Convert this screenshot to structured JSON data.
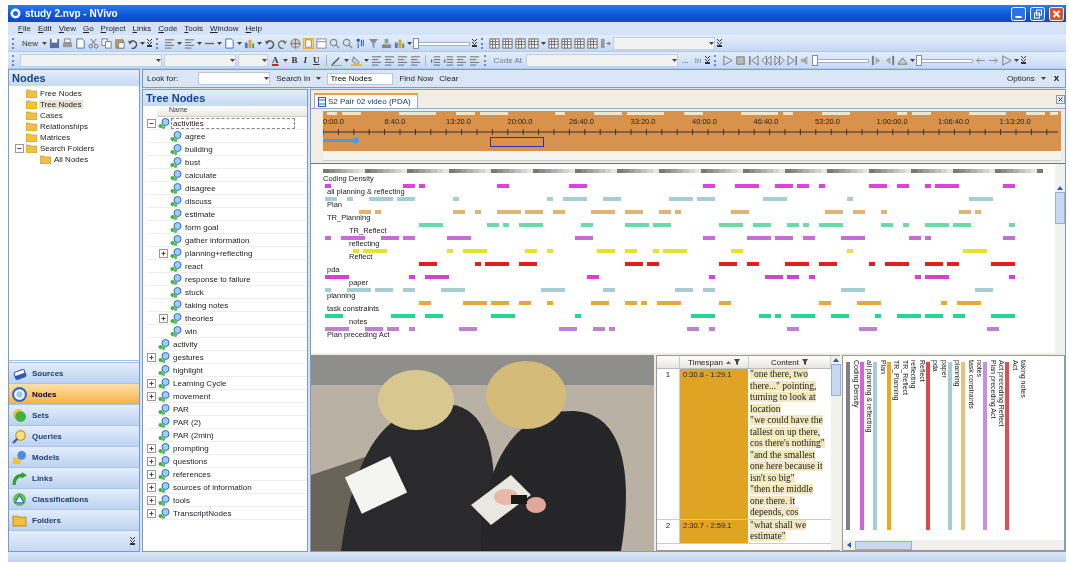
{
  "window": {
    "title": "study 2.nvp - NVivo"
  },
  "menu": [
    "File",
    "Edit",
    "View",
    "Go",
    "Project",
    "Links",
    "Code",
    "Tools",
    "Window",
    "Help"
  ],
  "toolbar": {
    "new_button": "New",
    "format_buttons": [
      "A",
      "B",
      "I",
      "U"
    ],
    "code_at": {
      "label": "Code At",
      "disabled": true
    },
    "ellipsis": "...",
    "in_button": {
      "label": "In",
      "disabled": true
    },
    "sliders": [
      {
        "level": 0
      },
      {
        "level": 0
      },
      {
        "level": 0
      }
    ]
  },
  "find_bar": {
    "look_for_label": "Look for:",
    "search_in": "Search In",
    "search_in_value": "Tree Nodes",
    "find_now": "Find Now",
    "clear": "Clear",
    "options": "Options",
    "close": "X"
  },
  "navigation": {
    "title": "Nodes",
    "folders": [
      {
        "label": "Free Nodes",
        "selected": false
      },
      {
        "label": "Tree Nodes",
        "selected": true
      },
      {
        "label": "Cases",
        "selected": false
      },
      {
        "label": "Relationships",
        "selected": false
      },
      {
        "label": "Matrices",
        "selected": false
      },
      {
        "label": "Search Folders",
        "selected": false,
        "expanded": true,
        "children": [
          {
            "label": "All Nodes",
            "selected": false
          }
        ]
      }
    ],
    "buttons": [
      {
        "label": "Sources",
        "selected": false
      },
      {
        "label": "Nodes",
        "selected": true
      },
      {
        "label": "Sets",
        "selected": false
      },
      {
        "label": "Queries",
        "selected": false
      },
      {
        "label": "Models",
        "selected": false
      },
      {
        "label": "Links",
        "selected": false
      },
      {
        "label": "Classifications",
        "selected": false
      },
      {
        "label": "Folders",
        "selected": false
      }
    ]
  },
  "node_list": {
    "title": "Tree Nodes",
    "column": "Name",
    "nodes": [
      {
        "label": "activities",
        "selected": true,
        "expanded": true,
        "children": [
          {
            "label": "agree",
            "selected": false
          },
          {
            "label": "building",
            "selected": false
          },
          {
            "label": "bust",
            "selected": false
          },
          {
            "label": "calculate",
            "selected": false
          },
          {
            "label": "disagree",
            "selected": false
          },
          {
            "label": "discuss",
            "selected": false
          },
          {
            "label": "estimate",
            "selected": false
          },
          {
            "label": "form goal",
            "selected": false
          },
          {
            "label": "gather information",
            "selected": false
          },
          {
            "label": "planning+reflecting",
            "selected": false,
            "expanded": false
          },
          {
            "label": "react",
            "selected": false
          },
          {
            "label": "response to failure",
            "selected": false
          },
          {
            "label": "stuck",
            "selected": false
          },
          {
            "label": "taking notes",
            "selected": false
          },
          {
            "label": "theories",
            "selected": false,
            "expanded": false
          },
          {
            "label": "win",
            "selected": false
          }
        ]
      },
      {
        "label": "activity",
        "selected": false
      },
      {
        "label": "gestures",
        "selected": false,
        "expanded": false
      },
      {
        "label": "highlight",
        "selected": false
      },
      {
        "label": "Learning Cycle",
        "selected": false,
        "expanded": false
      },
      {
        "label": "movement",
        "selected": false,
        "expanded": false
      },
      {
        "label": "PAR",
        "selected": false
      },
      {
        "label": "PAR (2)",
        "selected": false
      },
      {
        "label": "PAR (2min)",
        "selected": false
      },
      {
        "label": "prompting",
        "selected": false,
        "expanded": false
      },
      {
        "label": "questions",
        "selected": false,
        "expanded": false
      },
      {
        "label": "references",
        "selected": false,
        "expanded": false
      },
      {
        "label": "sources of information",
        "selected": false,
        "expanded": false
      },
      {
        "label": "tools",
        "selected": false,
        "expanded": false
      },
      {
        "label": "TranscriptNodes",
        "selected": false,
        "expanded": false
      }
    ]
  },
  "document_tab": {
    "label": "S2 Pair 02 video (PDA)",
    "selected": true
  },
  "timeline": {
    "ticks": [
      "0:00.0",
      "6:40.0",
      "13:20.0",
      "20:00.0",
      "26:40.0",
      "33:20.0",
      "40:00.0",
      "46:40.0",
      "53:20.0",
      "1:00:00.0",
      "1:06:40.0",
      "1:13:20.0"
    ]
  },
  "coding_stripes": {
    "density_label": "Coding Density",
    "stripes": [
      {
        "label": "all planning & reflecting",
        "color": "#e040e0"
      },
      {
        "label": "Plan",
        "color": "#a8ccd4"
      },
      {
        "label": "TR_Planning",
        "color": "#e0b474",
        "children": [
          {
            "label": "TR_Reflect",
            "color": "#70d8a8"
          },
          {
            "label": "reflecting",
            "color": "#c070d0"
          },
          {
            "label": "Reflect",
            "color": "#e8e030"
          }
        ]
      },
      {
        "label": "pda",
        "color": "#e02020",
        "children": [
          {
            "label": "paper",
            "color": "#d840d0"
          }
        ]
      },
      {
        "label": "planning",
        "color": "#a8ccd4"
      },
      {
        "label": "task constraints",
        "color": "#e8a838",
        "children": [
          {
            "label": "notes",
            "color": "#20d890"
          }
        ]
      },
      {
        "label": "Plan preceding Act",
        "color": "#c080d0"
      }
    ]
  },
  "transcript": {
    "columns": [
      "Timespan",
      "Content"
    ],
    "rows": [
      {
        "number": "1",
        "timespan": "0:30.8 - 1:29.1",
        "content": [
          "\"one there, two there...\" pointing, turning to look at location",
          "\"we could have the tallest on up there, cos there's nothing\"",
          "\"and the smallest one here because it isn't so big\"",
          "\"then the middle one there.  it depends, cos"
        ]
      },
      {
        "number": "2",
        "timespan": "2:30.7 - 2:59.1",
        "content": [
          "\"what shall we estimate\""
        ]
      }
    ]
  },
  "vertical_stripes": [
    {
      "label": "Coding Density",
      "color": "#808080"
    },
    {
      "label": "all planning & reflecting",
      "color": "#d860d8"
    },
    {
      "label": "Plan",
      "color": "#a8ccd4"
    },
    {
      "label": "TR_Planning",
      "color": "#f0a818"
    },
    {
      "label": "TR_Reflect"
    },
    {
      "label": "reflecting"
    },
    {
      "label": "Reflect"
    },
    {
      "label": "pda",
      "color": "#e04848"
    },
    {
      "label": "paper"
    },
    {
      "label": "planning",
      "color": "#a8ccd4"
    },
    {
      "label": "task constraints",
      "color": "#e8c080"
    },
    {
      "label": "notes"
    },
    {
      "label": "Plan preceding Act",
      "color": "#c890d8"
    },
    {
      "label": "Act preceding Reflect"
    },
    {
      "label": "Act",
      "color": "#e05050"
    },
    {
      "label": "taking notes"
    }
  ]
}
